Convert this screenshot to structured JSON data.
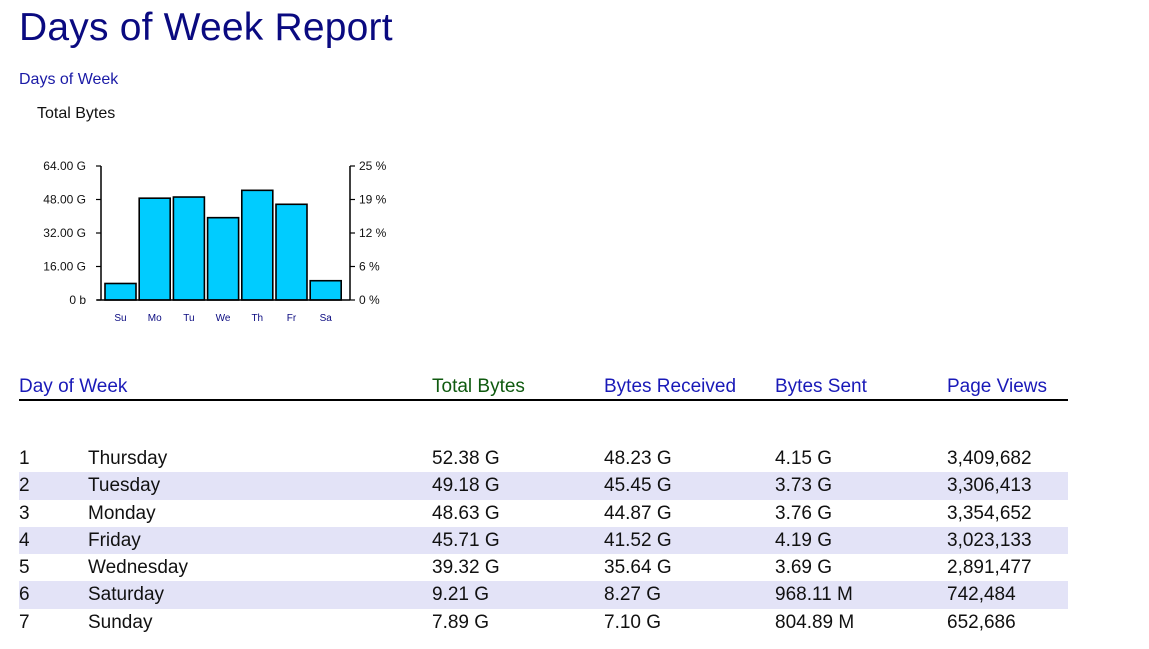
{
  "page_title": "Days of Week Report",
  "section_link": "Days of Week",
  "chart_title": "Total Bytes",
  "chart_data": {
    "type": "bar",
    "title": "Total Bytes",
    "categories": [
      "Su",
      "Mo",
      "Tu",
      "We",
      "Th",
      "Fr",
      "Sa"
    ],
    "values": [
      7.89,
      48.63,
      49.18,
      39.32,
      52.38,
      45.71,
      9.21
    ],
    "unit": "G",
    "ylim": [
      0,
      64
    ],
    "y_ticks": [
      "0 b",
      "16.00 G",
      "32.00 G",
      "48.00 G",
      "64.00 G"
    ],
    "y2_ticks": [
      "0 %",
      "6 %",
      "12 %",
      "19 %",
      "25 %"
    ],
    "bar_color": "#00ccff",
    "grid": false
  },
  "table": {
    "headers": {
      "day_of_week": "Day of Week",
      "total_bytes": "Total Bytes",
      "bytes_received": "Bytes Received",
      "bytes_sent": "Bytes Sent",
      "page_views": "Page Views"
    },
    "rows": [
      {
        "rank": "1",
        "day": "Thursday",
        "total": "52.38 G",
        "received": "48.23 G",
        "sent": "4.15 G",
        "views": "3,409,682"
      },
      {
        "rank": "2",
        "day": "Tuesday",
        "total": "49.18 G",
        "received": "45.45 G",
        "sent": "3.73 G",
        "views": "3,306,413"
      },
      {
        "rank": "3",
        "day": "Monday",
        "total": "48.63 G",
        "received": "44.87 G",
        "sent": "3.76 G",
        "views": "3,354,652"
      },
      {
        "rank": "4",
        "day": "Friday",
        "total": "45.71 G",
        "received": "41.52 G",
        "sent": "4.19 G",
        "views": "3,023,133"
      },
      {
        "rank": "5",
        "day": "Wednesday",
        "total": "39.32 G",
        "received": "35.64 G",
        "sent": "3.69 G",
        "views": "2,891,477"
      },
      {
        "rank": "6",
        "day": "Saturday",
        "total": "9.21 G",
        "received": "8.27 G",
        "sent": "968.11 M",
        "views": "742,484"
      },
      {
        "rank": "7",
        "day": "Sunday",
        "total": "7.89 G",
        "received": "7.10 G",
        "sent": "804.89 M",
        "views": "652,686"
      }
    ]
  },
  "colors": {
    "title": "#0a0a80",
    "link": "#1a1ab8",
    "sorted_header": "#0f5a0f",
    "row_alt": "#e3e3f7",
    "bar": "#00ccff"
  }
}
